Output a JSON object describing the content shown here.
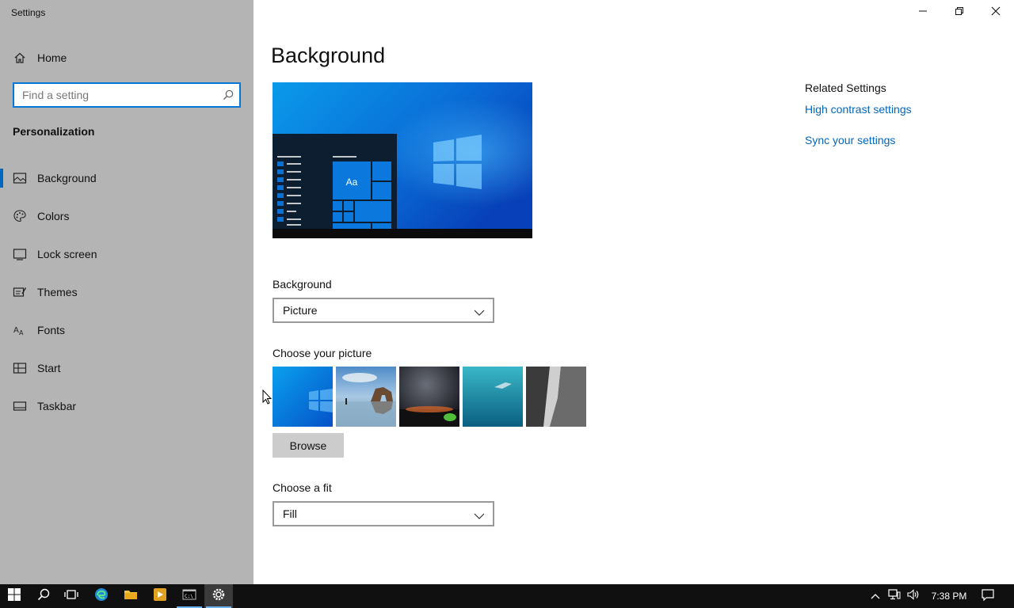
{
  "window": {
    "title": "Settings",
    "minimize_icon": "minimize-icon",
    "restore_icon": "restore-icon",
    "close_icon": "close-icon"
  },
  "sidebar": {
    "home_label": "Home",
    "search_placeholder": "Find a setting",
    "search_value": "",
    "section_heading": "Personalization",
    "selected": "Background",
    "items": [
      {
        "label": "Background",
        "icon": "picture-icon"
      },
      {
        "label": "Colors",
        "icon": "palette-icon"
      },
      {
        "label": "Lock screen",
        "icon": "lock-screen-icon"
      },
      {
        "label": "Themes",
        "icon": "themes-icon"
      },
      {
        "label": "Fonts",
        "icon": "fonts-icon"
      },
      {
        "label": "Start",
        "icon": "start-icon"
      },
      {
        "label": "Taskbar",
        "icon": "taskbar-icon"
      }
    ]
  },
  "main": {
    "title": "Background",
    "preview_tile_text": "Aa",
    "background_label": "Background",
    "background_value": "Picture",
    "choose_picture_label": "Choose your picture",
    "pictures": [
      "windows-blue-light",
      "beach-rock-arch",
      "night-sky-milky-way",
      "underwater-swimmer",
      "rock-cliff-face"
    ],
    "browse_label": "Browse",
    "fit_label": "Choose a fit",
    "fit_value": "Fill"
  },
  "related": {
    "heading": "Related Settings",
    "links": [
      "High contrast settings",
      "Sync your settings"
    ]
  },
  "taskbar": {
    "items": [
      "start-icon",
      "search-icon",
      "task-view-icon",
      "edge-icon",
      "file-explorer-icon",
      "media-player-icon",
      "command-prompt-icon",
      "settings-icon"
    ],
    "active_item": "settings-icon",
    "tray_icons": [
      "chevron-up-icon",
      "network-icon",
      "volume-icon"
    ],
    "clock": "7:38 PM",
    "notification_icon": "notification-icon"
  },
  "colors": {
    "accent": "#0067c0",
    "sidebar_bg": "#b4b4b4",
    "taskbar_bg": "#101010",
    "link": "#0067c0"
  }
}
